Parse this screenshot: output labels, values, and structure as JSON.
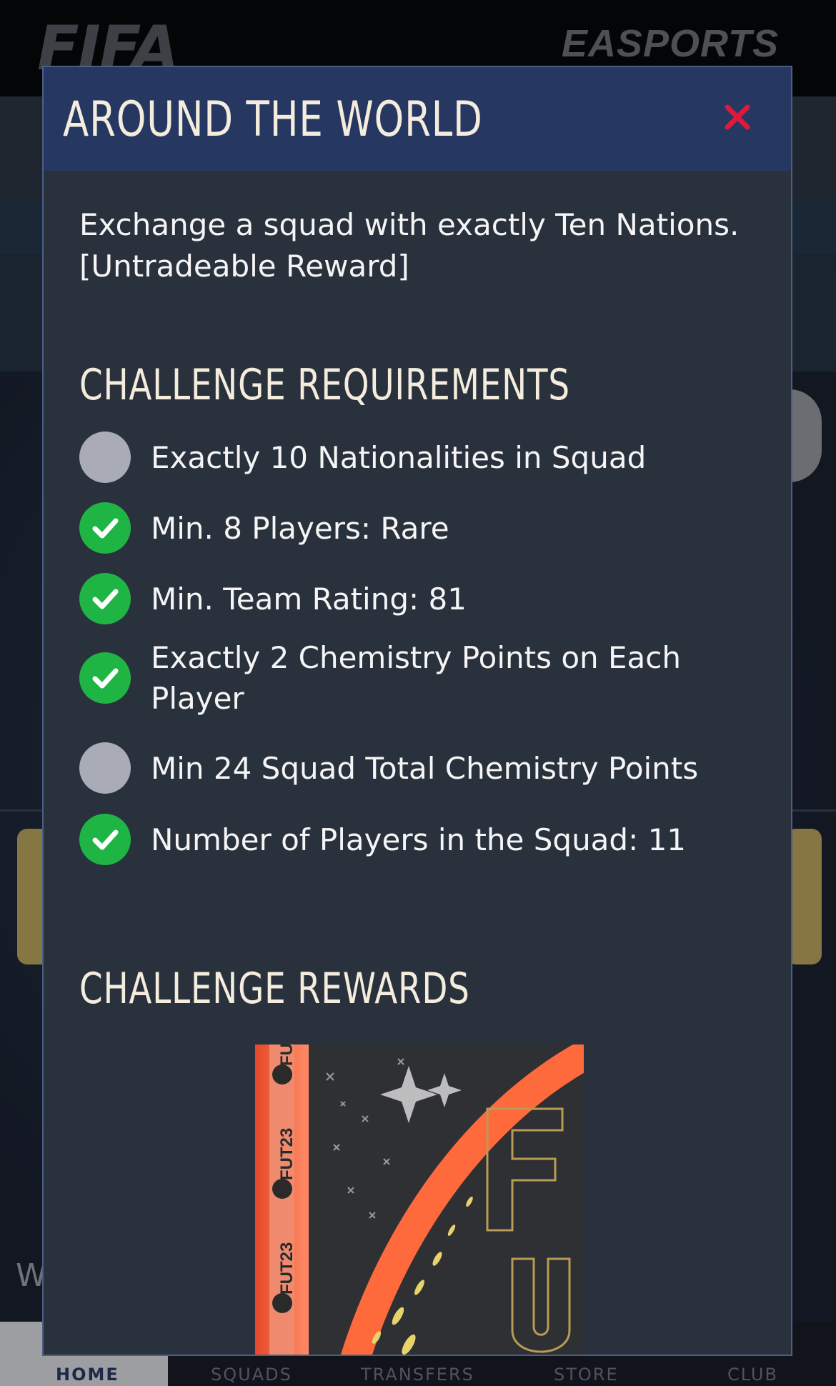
{
  "background": {
    "brand_logo": "FIFA",
    "publisher_logo": "EASPORTS",
    "partial_text_w": "W",
    "bottom_nav": [
      "HOME",
      "SQUADS",
      "TRANSFERS",
      "STORE",
      "CLUB"
    ]
  },
  "modal": {
    "title": "AROUND THE WORLD",
    "close_icon": "close-icon",
    "description": "Exchange a squad with exactly Ten Nations. [Untradeable Reward]",
    "requirements_title": "CHALLENGE REQUIREMENTS",
    "requirements": [
      {
        "label": "Exactly 10 Nationalities in Squad",
        "met": false
      },
      {
        "label": "Min. 8 Players: Rare",
        "met": true
      },
      {
        "label": "Min. Team Rating: 81",
        "met": true
      },
      {
        "label": "Exactly 2 Chemistry Points on Each Player",
        "met": true
      },
      {
        "label": "Min 24 Squad Total Chemistry Points",
        "met": false
      },
      {
        "label": "Number of Players in the Squad: 11",
        "met": true
      }
    ],
    "rewards_title": "CHALLENGE REWARDS",
    "reward_pack_text": "FUT23"
  },
  "colors": {
    "header": "#263762",
    "close": "#e0183c",
    "met": "#1fb545",
    "unmet": "#a9acb6",
    "pack_accent": "#ff6a3d"
  }
}
